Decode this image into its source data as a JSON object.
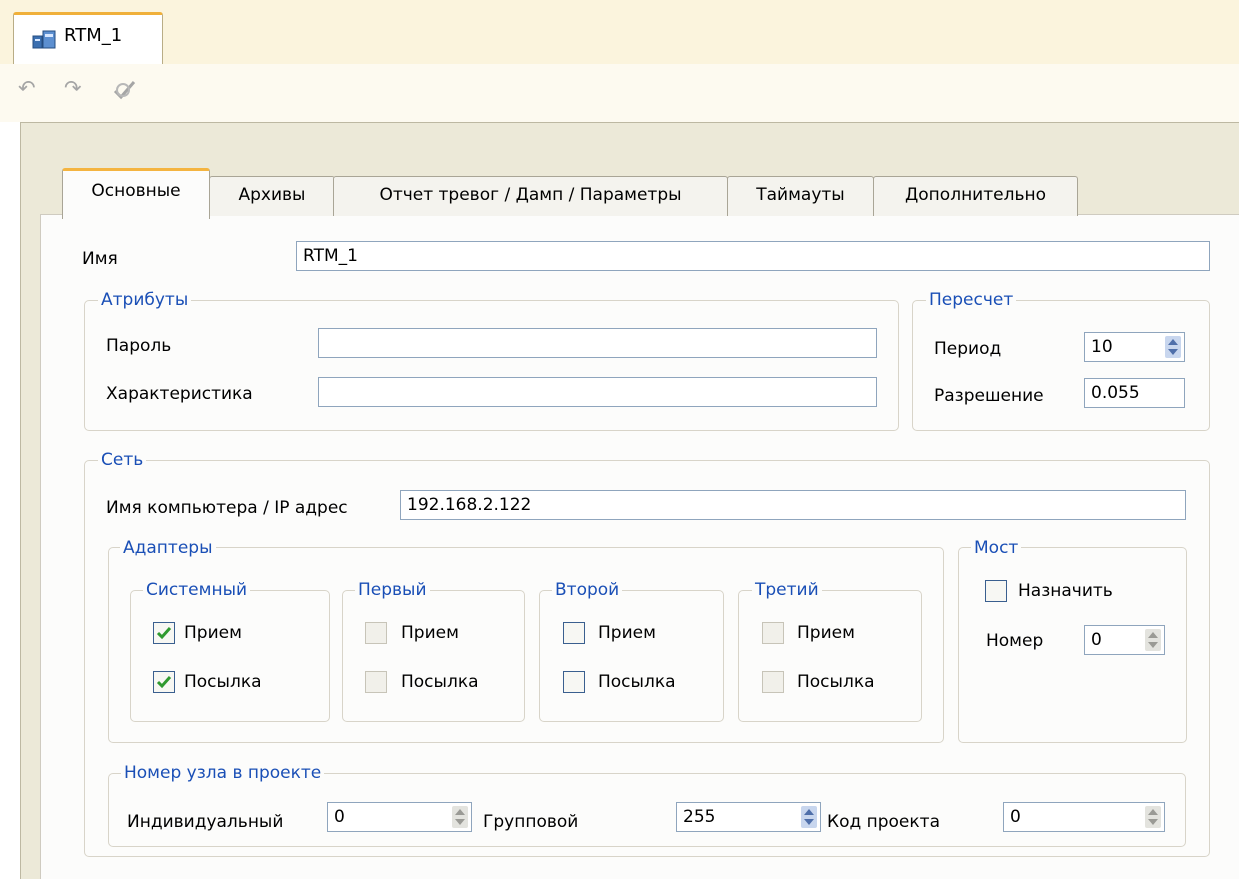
{
  "document_tab": {
    "label": "RTM_1"
  },
  "toolbar": {
    "icons": [
      "undo-icon",
      "redo-icon",
      "check-edit-icon"
    ]
  },
  "tabs": [
    {
      "label": "Основные",
      "active": true
    },
    {
      "label": "Архивы",
      "active": false
    },
    {
      "label": "Отчет тревог / Дамп / Параметры",
      "active": false
    },
    {
      "label": "Таймауты",
      "active": false
    },
    {
      "label": "Дополнительно",
      "active": false
    }
  ],
  "name": {
    "label": "Имя",
    "value": "RTM_1"
  },
  "attributes": {
    "title": "Атрибуты",
    "password_label": "Пароль",
    "password_value": "",
    "characteristic_label": "Характеристика",
    "characteristic_value": ""
  },
  "recalc": {
    "title": "Пересчет",
    "period_label": "Период",
    "period_value": "10",
    "resolution_label": "Разрешение",
    "resolution_value": "0.055"
  },
  "network": {
    "title": "Сеть",
    "host_label": "Имя компьютера / IP адрес",
    "host_value": "192.168.2.122",
    "adapters": {
      "title": "Адаптеры",
      "groups": [
        {
          "title": "Системный",
          "receive_label": "Прием",
          "send_label": "Посылка",
          "receive_checked": true,
          "send_checked": true,
          "enabled": true
        },
        {
          "title": "Первый",
          "receive_label": "Прием",
          "send_label": "Посылка",
          "receive_checked": false,
          "send_checked": false,
          "enabled": false
        },
        {
          "title": "Второй",
          "receive_label": "Прием",
          "send_label": "Посылка",
          "receive_checked": false,
          "send_checked": false,
          "enabled": true
        },
        {
          "title": "Третий",
          "receive_label": "Прием",
          "send_label": "Посылка",
          "receive_checked": false,
          "send_checked": false,
          "enabled": false
        }
      ]
    },
    "bridge": {
      "title": "Мост",
      "assign_label": "Назначить",
      "assign_checked": false,
      "number_label": "Номер",
      "number_value": "0"
    }
  },
  "node": {
    "title": "Номер узла в проекте",
    "individual_label": "Индивидуальный",
    "individual_value": "0",
    "group_label": "Групповой",
    "group_value": "255",
    "project_code_label": "Код проекта",
    "project_code_value": "0"
  },
  "colors": {
    "accent_tab": "#f4b440",
    "group_title": "#1a4fb6",
    "check": "#2f9a2f"
  }
}
